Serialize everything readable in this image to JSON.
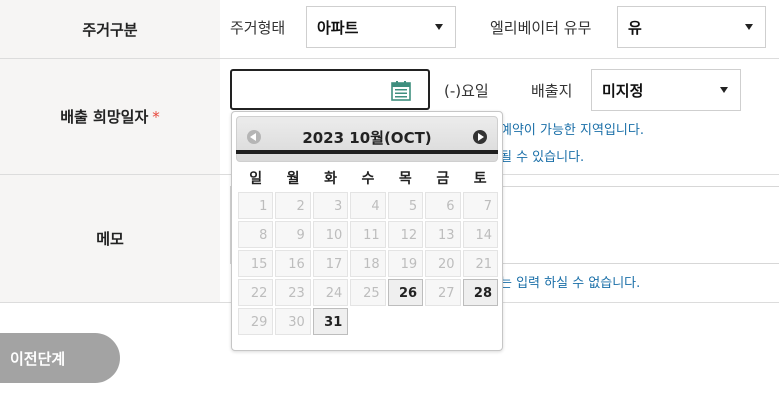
{
  "rows": {
    "housing_label": "주거구분",
    "delivery_label": "배출 희망일자",
    "required_mark": "*",
    "memo_label": "메모"
  },
  "housing": {
    "type_label": "주거형태",
    "type_value": "아파트",
    "elevator_label": "엘리베이터 유무",
    "elevator_value": "유"
  },
  "delivery": {
    "date_value": "",
    "weekday_text": "(-)요일",
    "origin_label": "배출지",
    "origin_value": "미지정",
    "info_line1": "예약이 가능한 지역입니다.",
    "info_line2": "될 수 있습니다."
  },
  "memo": {
    "info": "는 입력 하실 수 없습니다."
  },
  "buttons": {
    "prev_step": "이전단계"
  },
  "datepicker": {
    "title": "2023 10월(OCT)",
    "weekdays": [
      "일",
      "월",
      "화",
      "수",
      "목",
      "금",
      "토"
    ],
    "enabled_days": [
      26,
      28,
      31
    ],
    "weeks": [
      [
        "1",
        "2",
        "3",
        "4",
        "5",
        "6",
        "7"
      ],
      [
        "8",
        "9",
        "10",
        "11",
        "12",
        "13",
        "14"
      ],
      [
        "15",
        "16",
        "17",
        "18",
        "19",
        "20",
        "21"
      ],
      [
        "22",
        "23",
        "24",
        "25",
        "26",
        "27",
        "28"
      ],
      [
        "29",
        "30",
        "31",
        "",
        "",
        "",
        ""
      ]
    ]
  },
  "colors": {
    "info_text": "#1a6fa8",
    "label_background": "#f6f5f4",
    "prev_button": "#a3a3a3"
  },
  "icons": {
    "calendar": "calendar-icon",
    "prev_month": "prev-month-icon",
    "next_month": "next-month-icon",
    "dropdown": "chevron-down-icon"
  }
}
